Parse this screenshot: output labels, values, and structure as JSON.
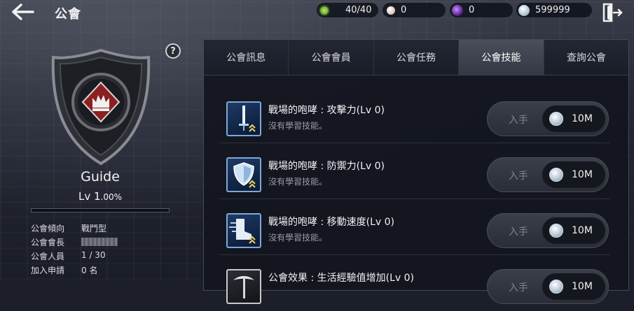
{
  "header": {
    "title": "公會",
    "resources": [
      {
        "name": "stamina",
        "icon": "green-gem-icon",
        "value": "40/40"
      },
      {
        "name": "pearl",
        "icon": "pearl-icon",
        "value": "0"
      },
      {
        "name": "dark-orb",
        "icon": "purple-orb-icon",
        "value": "0"
      },
      {
        "name": "silver",
        "icon": "silver-coin-icon",
        "value": "599999"
      }
    ]
  },
  "guild": {
    "name": "Guide",
    "level_prefix": "Lv 1",
    "level_pct": ".00%",
    "exp_progress": 0.0,
    "info": [
      {
        "label": "公會傾向",
        "value": "戰鬥型"
      },
      {
        "label": "公會會長",
        "value": ""
      },
      {
        "label": "公會人員",
        "value": "1 / 30"
      },
      {
        "label": "加入申請",
        "value": "0 名"
      }
    ]
  },
  "tabs": [
    {
      "label": "公會訊息",
      "active": false
    },
    {
      "label": "公會會員",
      "active": false
    },
    {
      "label": "公會任務",
      "active": false
    },
    {
      "label": "公會技能",
      "active": true
    },
    {
      "label": "查詢公會",
      "active": false
    }
  ],
  "skills": [
    {
      "name": "戰場的咆哮 : 攻擊力(Lv 0)",
      "desc": "沒有學習技能。",
      "icon": "sword-icon",
      "acquire_label": "入手",
      "cost": "10M"
    },
    {
      "name": "戰場的咆哮 : 防禦力(Lv 0)",
      "desc": "沒有學習技能。",
      "icon": "shield-icon",
      "acquire_label": "入手",
      "cost": "10M"
    },
    {
      "name": "戰場的咆哮 : 移動速度(Lv 0)",
      "desc": "沒有學習技能。",
      "icon": "boot-icon",
      "acquire_label": "入手",
      "cost": "10M"
    },
    {
      "name": "公會效果 : 生活經驗值增加(Lv 0)",
      "desc": "",
      "icon": "pickaxe-icon",
      "acquire_label": "入手",
      "cost": "10M"
    }
  ],
  "colors": {
    "accent": "#7fa8d8",
    "active_tab": "#4a4f5c",
    "crest_red": "#8c1f22"
  }
}
